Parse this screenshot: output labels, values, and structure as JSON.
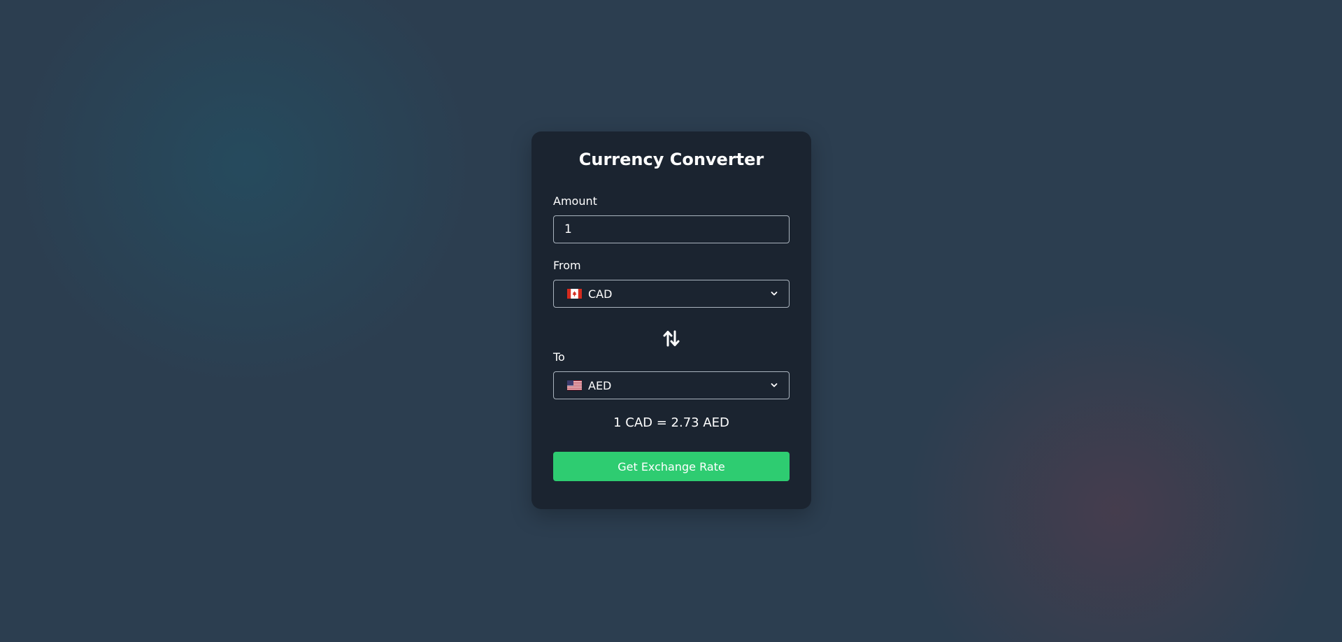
{
  "converter": {
    "title": "Currency Converter",
    "amount": {
      "label": "Amount",
      "value": "1"
    },
    "from": {
      "label": "From",
      "flag_icon": "canada-flag-icon",
      "currency": "CAD"
    },
    "to": {
      "label": "To",
      "flag_icon": "us-flag-icon",
      "currency": "AED"
    },
    "swap_icon": "swap-arrows-icon",
    "rate_text": "1 CAD = 2.73 AED",
    "button_label": "Get Exchange Rate"
  },
  "colors": {
    "background": "#2c3e50",
    "card": "#1b2430",
    "button": "#2ecc71",
    "text": "#ffffff"
  }
}
